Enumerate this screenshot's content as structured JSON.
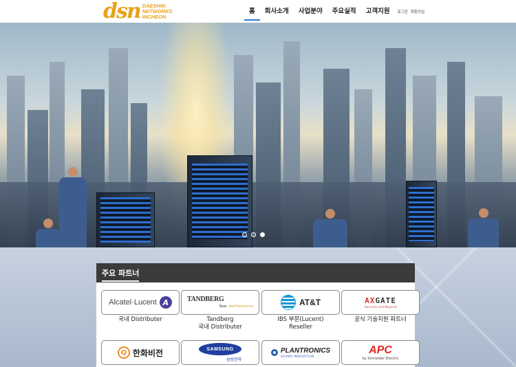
{
  "brand": {
    "mark": "dsn",
    "lines": [
      "DAESHIN",
      "NETWORKS",
      "INCHEON"
    ],
    "color": "#e8a21a"
  },
  "nav": {
    "items": [
      {
        "label": "홈",
        "active": true
      },
      {
        "label": "회사소개"
      },
      {
        "label": "사업분야"
      },
      {
        "label": "주요실적"
      },
      {
        "label": "고객지원"
      }
    ],
    "login": "로그인",
    "signup": "회원가입",
    "accent": "#2a7ad6"
  },
  "hero": {
    "slide_count": 3,
    "active_slide": 3
  },
  "partners": {
    "title": "주요 파트너",
    "cards": [
      {
        "logo": {
          "word": "Alcatel·Lucent",
          "icon": "A"
        },
        "caption": [
          "국내 Distributer"
        ]
      },
      {
        "logo": {
          "word": "TANDBERG",
          "sub1": "See:",
          "sub2": "performance"
        },
        "caption": [
          "Tandberg",
          "국내 Distributer"
        ]
      },
      {
        "logo": {
          "word": "AT&T"
        },
        "caption": [
          "IBS 부문(Lucent)",
          "Reseller"
        ]
      },
      {
        "logo": {
          "word_a": "AX",
          "word_b": "GATE",
          "sub": "Security and Beyond"
        },
        "caption": [
          "공식 기술지원 파트너"
        ]
      },
      {
        "logo": {
          "word": "한화비전",
          "icon": "Q"
        },
        "caption": []
      },
      {
        "logo": {
          "word": "SAMSUNG",
          "sub": "삼성전자"
        },
        "caption": []
      },
      {
        "logo": {
          "word": "PLANTRONICS",
          "sub": "SOUND INNOVATION"
        },
        "caption": []
      },
      {
        "logo": {
          "word": "APC",
          "sub": "by Schneider Electric"
        },
        "caption": []
      }
    ]
  }
}
